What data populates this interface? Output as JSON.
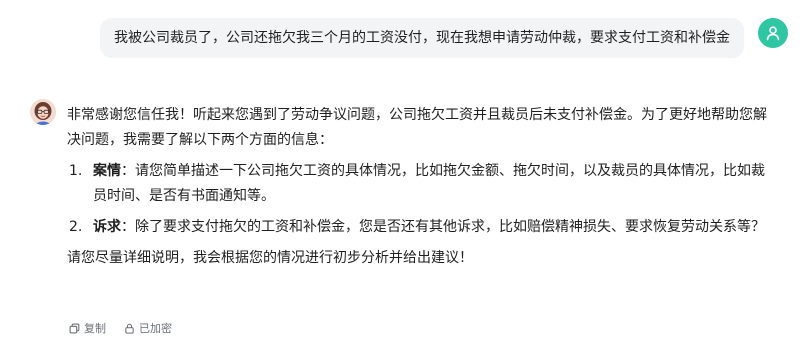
{
  "user_message": {
    "text": "我被公司裁员了，公司还拖欠我三个月的工资没付，现在我想申请劳动仲裁，要求支付工资和补偿金",
    "avatar_icon": "user-icon",
    "avatar_color": "#2fc6a4"
  },
  "assistant_message": {
    "avatar_icon": "assistant-avatar",
    "intro": "非常感谢您信任我！听起来您遇到了劳动争议问题，公司拖欠工资并且裁员后未支付补偿金。为了更好地帮助您解决问题，我需要了解以下两个方面的信息：",
    "items": [
      {
        "number": "1.",
        "title": "案情",
        "text": "：请您简单描述一下公司拖欠工资的具体情况，比如拖欠金额、拖欠时间，以及裁员的具体情况，比如裁员时间、是否有书面通知等。"
      },
      {
        "number": "2.",
        "title": "诉求",
        "text": "：除了要求支付拖欠的工资和补偿金，您是否还有其他诉求，比如赔偿精神损失、要求恢复劳动关系等？"
      }
    ],
    "closing": "请您尽量详细说明，我会根据您的情况进行初步分析并给出建议！"
  },
  "actions": {
    "copy_label": "复制",
    "copy_icon": "copy-icon",
    "encrypted_label": "已加密",
    "encrypted_icon": "lock-icon"
  }
}
